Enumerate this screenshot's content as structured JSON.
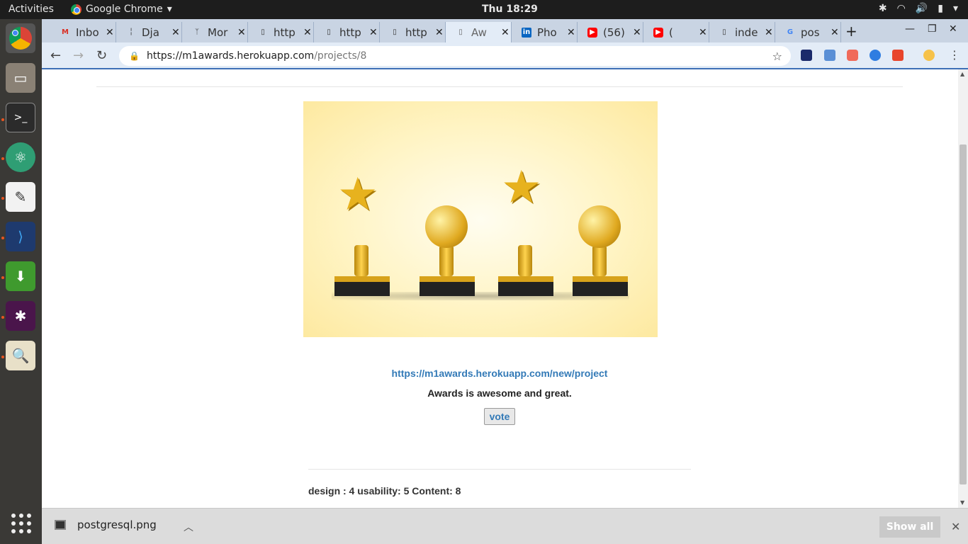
{
  "topbar": {
    "activities": "Activities",
    "app_name": "Google Chrome",
    "clock": "Thu 18:29"
  },
  "tabs": [
    {
      "title": "Inbo",
      "icon": "gmail-icon"
    },
    {
      "title": "Dja",
      "icon": "django-icon"
    },
    {
      "title": "Mor",
      "icon": "mongoose-icon"
    },
    {
      "title": "http",
      "icon": "page-icon"
    },
    {
      "title": "http",
      "icon": "page-icon"
    },
    {
      "title": "http",
      "icon": "page-icon"
    },
    {
      "title": "Aw",
      "icon": "page-icon",
      "active": true
    },
    {
      "title": "Pho",
      "icon": "linkedin-icon"
    },
    {
      "title": "(56)",
      "icon": "youtube-icon"
    },
    {
      "title": "(",
      "icon": "youtube-icon"
    },
    {
      "title": "inde",
      "icon": "page-icon"
    },
    {
      "title": "pos",
      "icon": "google-icon"
    }
  ],
  "address_bar": {
    "url_host": "https://m1awards.herokuapp.com",
    "url_path": "/projects/8"
  },
  "project": {
    "link": "https://m1awards.herokuapp.com/new/project",
    "description": "Awards is awesome and great.",
    "vote_label": "vote",
    "ratings": "design : 4 usability: 5 Content: 8"
  },
  "download_shelf": {
    "file_name": "postgresql.png",
    "show_all_label": "Show all"
  },
  "colors": {
    "link": "#337ab7",
    "tab_strip": "#c9d4e3",
    "toolbar": "#e3ecf7",
    "dock": "#3a3936"
  }
}
